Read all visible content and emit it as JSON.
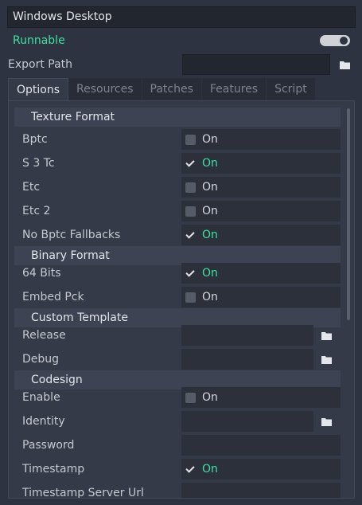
{
  "preset": {
    "name": "Windows Desktop",
    "runnable_label": "Runnable",
    "runnable": true
  },
  "export": {
    "label": "Export Path",
    "value": ""
  },
  "tabs": [
    {
      "label": "Options",
      "active": true
    },
    {
      "label": "Resources",
      "active": false
    },
    {
      "label": "Patches",
      "active": false
    },
    {
      "label": "Features",
      "active": false
    },
    {
      "label": "Script",
      "active": false
    }
  ],
  "sections": {
    "texture_format": "Texture Format",
    "binary_format": "Binary Format",
    "custom_template": "Custom Template",
    "codesign": "Codesign"
  },
  "props": {
    "bptc": {
      "label": "Bptc",
      "text": "On",
      "checked": false
    },
    "s3tc": {
      "label": "S 3 Tc",
      "text": "On",
      "checked": true
    },
    "etc": {
      "label": "Etc",
      "text": "On",
      "checked": false
    },
    "etc2": {
      "label": "Etc 2",
      "text": "On",
      "checked": false
    },
    "no_bptc_fallbacks": {
      "label": "No Bptc Fallbacks",
      "text": "On",
      "checked": true
    },
    "bits64": {
      "label": "64 Bits",
      "text": "On",
      "checked": true
    },
    "embed_pck": {
      "label": "Embed Pck",
      "text": "On",
      "checked": false
    },
    "release": {
      "label": "Release",
      "value": ""
    },
    "debug": {
      "label": "Debug",
      "value": ""
    },
    "enable": {
      "label": "Enable",
      "text": "On",
      "checked": false
    },
    "identity": {
      "label": "Identity",
      "value": ""
    },
    "password": {
      "label": "Password",
      "value": ""
    },
    "timestamp": {
      "label": "Timestamp",
      "text": "On",
      "checked": true
    },
    "timestamp_server_url": {
      "label": "Timestamp Server Url",
      "value": ""
    }
  },
  "colors": {
    "accent": "#42e0a0",
    "background": "#2d3340",
    "panel": "#343a47"
  }
}
